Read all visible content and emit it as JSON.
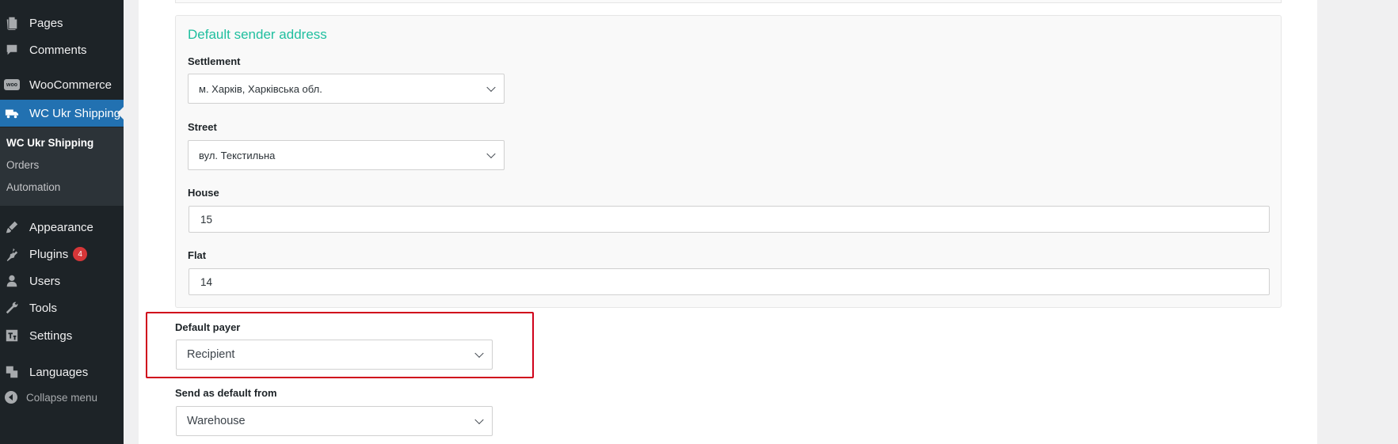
{
  "sidebar": {
    "items": [
      {
        "label": "Pages",
        "icon": "pages-icon"
      },
      {
        "label": "Comments",
        "icon": "comments-icon"
      },
      {
        "label": "WooCommerce",
        "icon": "woocommerce-icon"
      },
      {
        "label": "WC Ukr Shipping",
        "icon": "truck-icon"
      },
      {
        "label": "Appearance",
        "icon": "paintbrush-icon"
      },
      {
        "label": "Plugins",
        "icon": "plugin-icon",
        "badge": "4"
      },
      {
        "label": "Users",
        "icon": "user-icon"
      },
      {
        "label": "Tools",
        "icon": "wrench-icon"
      },
      {
        "label": "Settings",
        "icon": "settings-icon"
      },
      {
        "label": "Languages",
        "icon": "translate-icon"
      }
    ],
    "submenu": [
      "WC Ukr Shipping",
      "Orders",
      "Automation"
    ],
    "collapse_label": "Collapse menu",
    "woo_icon_text": "woo"
  },
  "sender": {
    "title": "Default sender address",
    "settlement_label": "Settlement",
    "settlement_value": "м. Харків, Харківська обл.",
    "street_label": "Street",
    "street_value": "вул. Текстильна",
    "house_label": "House",
    "house_value": "15",
    "flat_label": "Flat",
    "flat_value": "14"
  },
  "payer": {
    "label": "Default payer",
    "value": "Recipient"
  },
  "send_from": {
    "label": "Send as default from",
    "value": "Warehouse"
  },
  "colors": {
    "accent": "#2271b1",
    "section_title": "#1fbf9f",
    "highlight": "#d0021b",
    "badge": "#d63638"
  }
}
